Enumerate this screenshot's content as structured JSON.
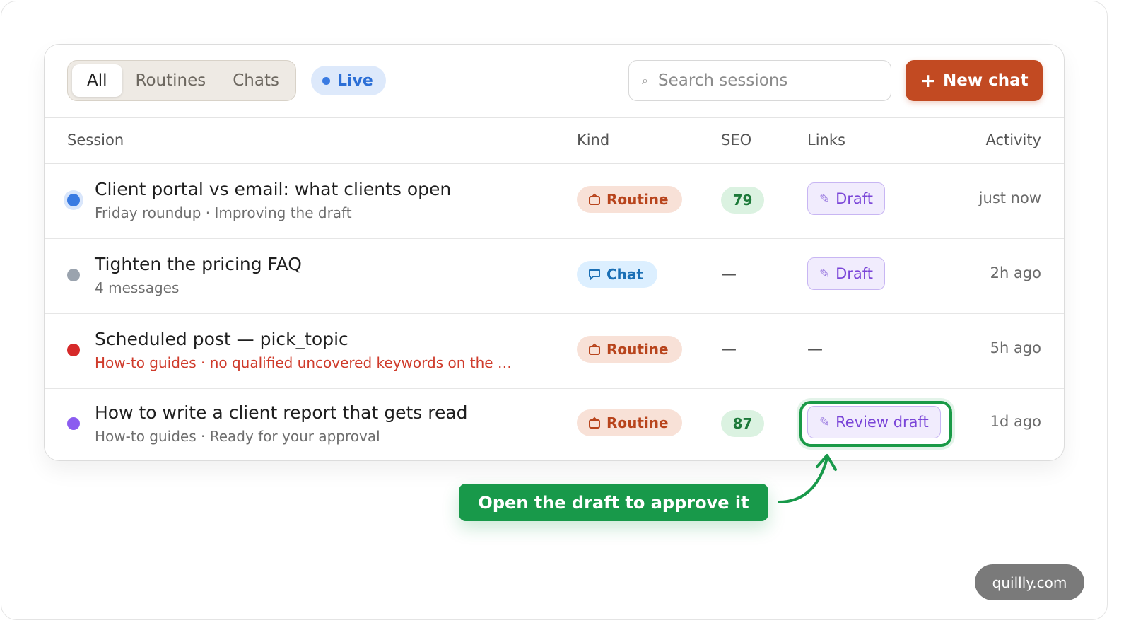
{
  "filters": {
    "tabs": [
      {
        "label": "All",
        "active": true
      },
      {
        "label": "Routines",
        "active": false
      },
      {
        "label": "Chats",
        "active": false
      }
    ],
    "live_label": "Live"
  },
  "search": {
    "placeholder": "Search sessions"
  },
  "new_chat_label": "New chat",
  "columns": {
    "session": "Session",
    "kind": "Kind",
    "seo": "SEO",
    "links": "Links",
    "activity": "Activity"
  },
  "rows": [
    {
      "title": "Client portal vs email: what clients open",
      "subtitle": "Friday roundup · Improving the draft",
      "status_color": "#3a7be2",
      "kind": "Routine",
      "seo": "79",
      "link": "Draft",
      "activity": "just now"
    },
    {
      "title": "Tighten the pricing FAQ",
      "subtitle": "4 messages",
      "status_color": "#9aa3ae",
      "kind": "Chat",
      "seo": "—",
      "link": "Draft",
      "activity": "2h ago"
    },
    {
      "title": "Scheduled post — pick_topic",
      "subtitle": "How-to guides · no qualified uncovered keywords on the …",
      "status_color": "#d62a2a",
      "kind": "Routine",
      "seo": "—",
      "link": "—",
      "activity": "5h ago"
    },
    {
      "title": "How to write a client report that gets read",
      "subtitle": "How-to guides · Ready for your approval",
      "status_color": "#8b5cf0",
      "kind": "Routine",
      "seo": "87",
      "link": "Review draft",
      "activity": "1d ago"
    }
  ],
  "callout": "Open the draft to approve it",
  "watermark": "quillly.com",
  "colors": {
    "accent": "#c24a22",
    "callout": "#18994a",
    "live": "#2c6fd6"
  }
}
